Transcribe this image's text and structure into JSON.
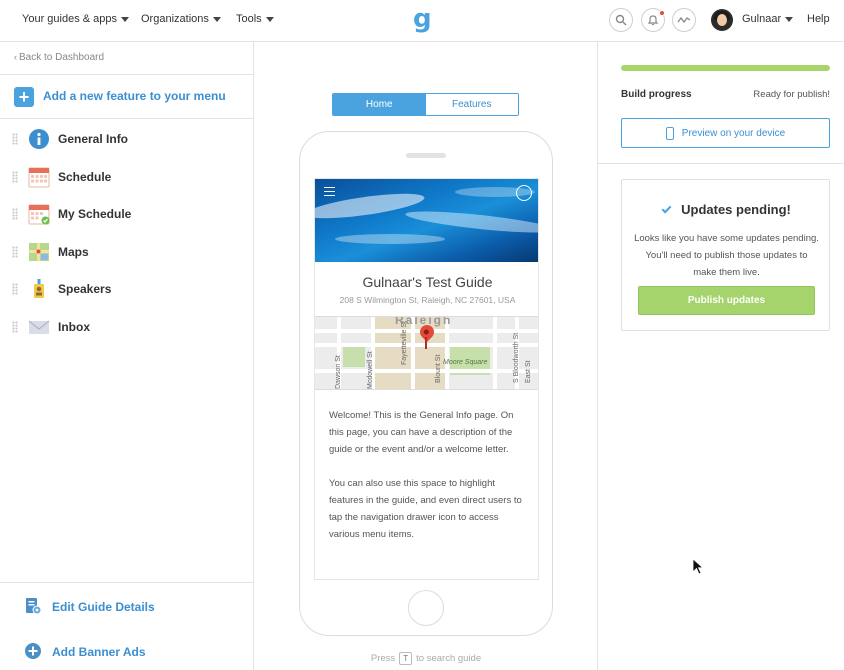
{
  "topnav": {
    "guides_apps": "Your guides & apps",
    "organizations": "Organizations",
    "tools": "Tools",
    "logo": "g",
    "user_name": "Gulnaar",
    "help": "Help"
  },
  "sidebar": {
    "back": "Back to Dashboard",
    "add_feature": "Add a new feature to your menu",
    "items": [
      {
        "label": "General Info",
        "icon": "info-icon"
      },
      {
        "label": "Schedule",
        "icon": "calendar-icon"
      },
      {
        "label": "My Schedule",
        "icon": "calendar-check-icon"
      },
      {
        "label": "Maps",
        "icon": "map-icon"
      },
      {
        "label": "Speakers",
        "icon": "speaker-badge-icon"
      },
      {
        "label": "Inbox",
        "icon": "envelope-icon"
      }
    ],
    "footer": {
      "edit_details": "Edit Guide Details",
      "banner_ads": "Add Banner Ads"
    }
  },
  "preview": {
    "tabs": {
      "home": "Home",
      "features": "Features"
    },
    "guide_title": "Gulnaar's Test Guide",
    "address": "208 S Wilmington St, Raleigh, NC 27601, USA",
    "map": {
      "city": "Raleigh",
      "park": "Moore Square",
      "streets": [
        "Fayetteville St",
        "Blount St",
        "S Bloodworth St",
        "East St",
        "Dawson St",
        "Mcdowell St"
      ]
    },
    "paragraphs": [
      "Welcome! This is the General Info page. On this page, you can have a description of the guide or the event and/or a welcome letter.",
      "You can also use this space to highlight features in the guide, and even direct users to tap the navigation drawer icon to access various menu items."
    ],
    "search_hint": {
      "press": "Press",
      "key": "T",
      "rest": "to search guide"
    }
  },
  "build": {
    "label": "Build progress",
    "status": "Ready for publish!",
    "progress": 1.0,
    "preview_button": "Preview on your device"
  },
  "updates": {
    "title": "Updates pending!",
    "description": "Looks like you have some updates pending. You'll need to publish those updates to make them live.",
    "publish_button": "Publish updates"
  },
  "colors": {
    "accent": "#4aa3df",
    "success": "#a6d46c",
    "alert": "#e74c3c"
  }
}
